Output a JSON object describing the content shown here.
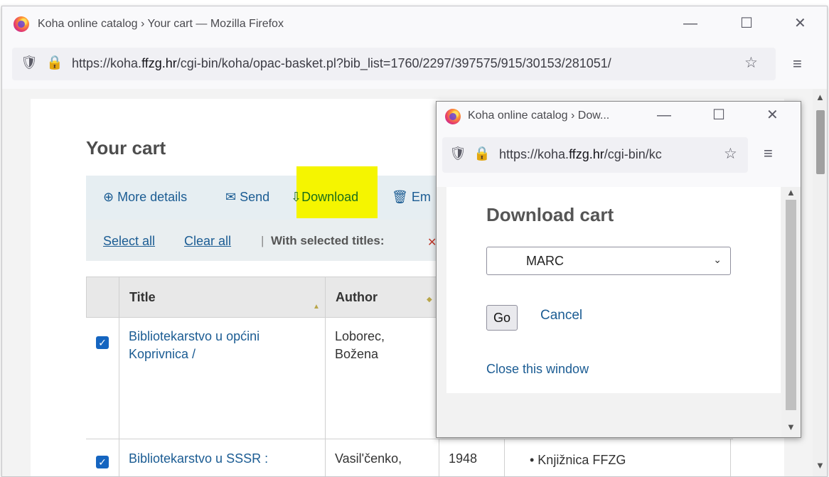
{
  "main_window": {
    "title": "Koha online catalog › Your cart — Mozilla Firefox",
    "url_prefix": "https://koha.",
    "url_domain": "ffzg.hr",
    "url_suffix": "/cgi-bin/koha/opac-basket.pl?bib_list=1760/2297/397575/915/30153/281051/",
    "controls": {
      "minimize": "—",
      "maximize": "☐",
      "close": "✕"
    }
  },
  "page": {
    "title": "Your cart",
    "toolbar": {
      "more_details": "More details",
      "send": "Send",
      "download": "Download",
      "empty": "Em"
    },
    "selection": {
      "select_all": "Select all",
      "clear_all": "Clear all",
      "separator": "|",
      "with_selected": "With selected titles:"
    },
    "table": {
      "headers": {
        "title": "Title",
        "author": "Author"
      },
      "rows": [
        {
          "title_line1": "Bibliotekarstvo u općini",
          "title_line2": "Koprivnica /",
          "author_line1": "Loborec,",
          "author_line2": "Božena"
        },
        {
          "title_line1": "Bibliotekarstvo u SSSR :",
          "author_line1": "Vasil'čenko,",
          "year": "1948",
          "location": "• Knjižnica FFZG"
        }
      ]
    }
  },
  "popup": {
    "title": "Koha online catalog › Dow...",
    "url_prefix": "https://koha.",
    "url_domain": "ffzg.hr",
    "url_suffix": "/cgi-bin/kc",
    "heading": "Download cart",
    "format_selected": "MARC",
    "go_label": "Go",
    "cancel_label": "Cancel",
    "close_label": "Close this window"
  },
  "colors": {
    "link": "#1b5c93",
    "highlight": "#f5f500",
    "checkbox": "#1565c0"
  }
}
